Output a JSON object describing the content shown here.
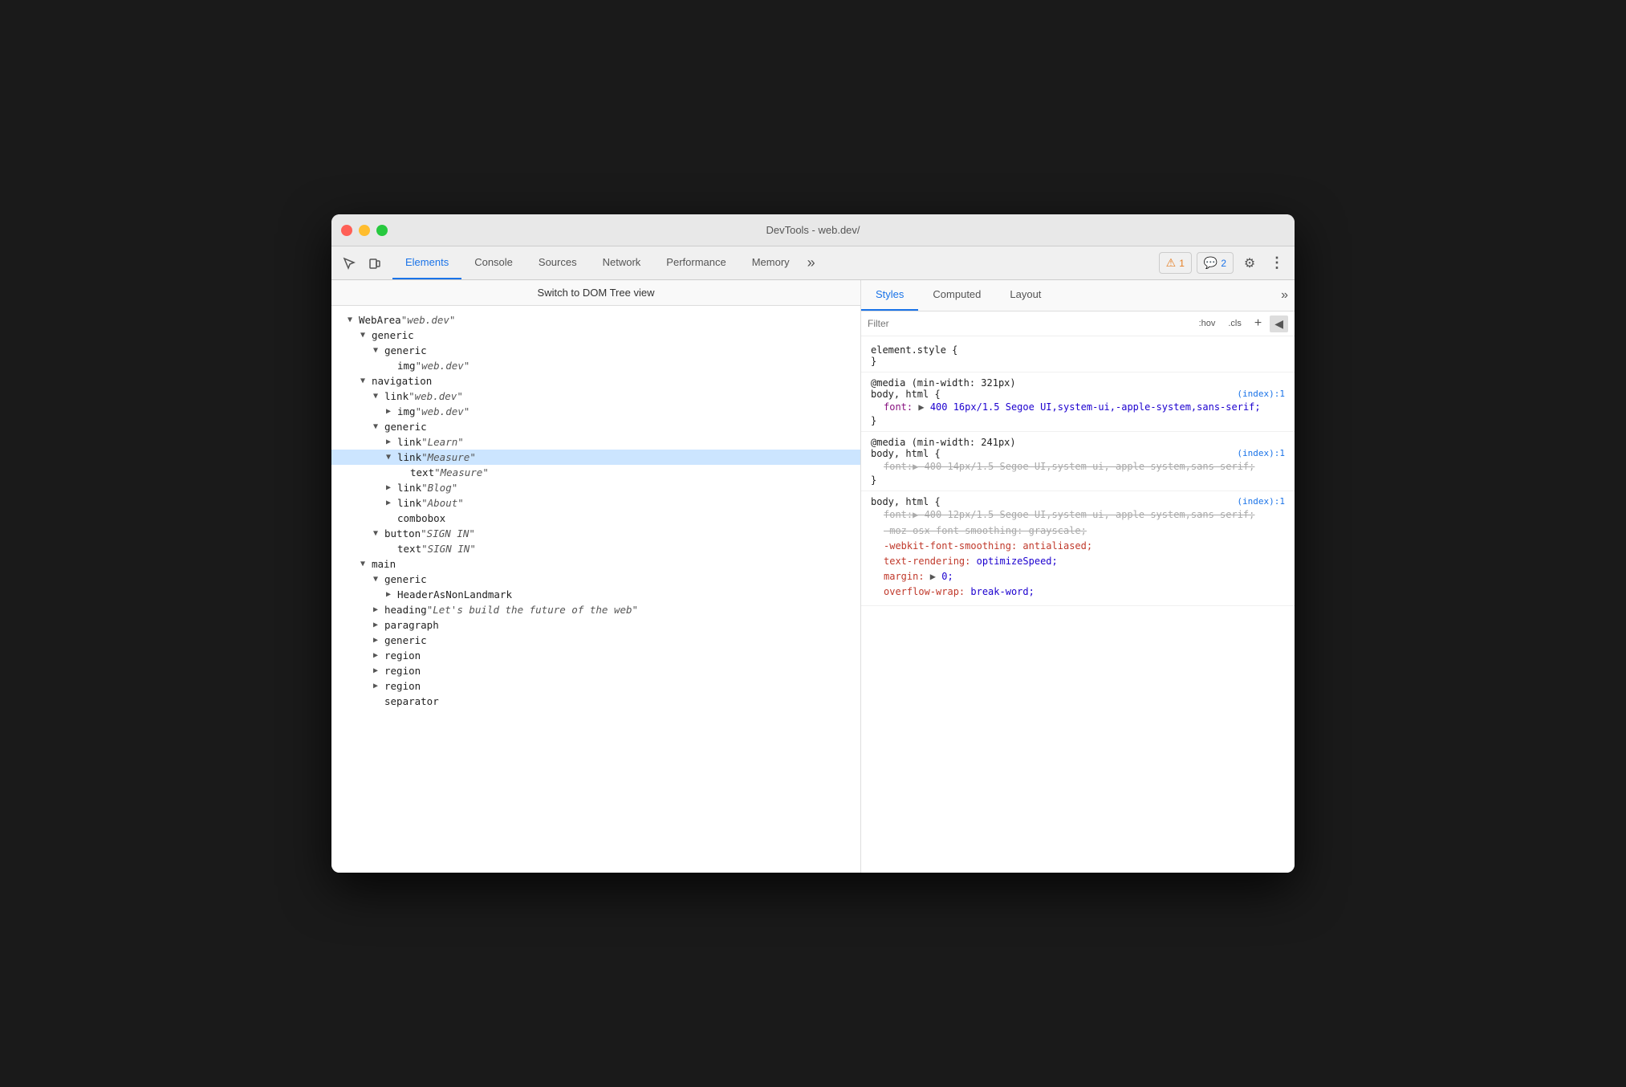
{
  "window": {
    "title": "DevTools - web.dev/"
  },
  "toolbar": {
    "tabs": [
      {
        "label": "Elements",
        "active": true
      },
      {
        "label": "Console",
        "active": false
      },
      {
        "label": "Sources",
        "active": false
      },
      {
        "label": "Network",
        "active": false
      },
      {
        "label": "Performance",
        "active": false
      },
      {
        "label": "Memory",
        "active": false
      }
    ],
    "more_label": "»",
    "warn_count": "1",
    "info_count": "2"
  },
  "dom_panel": {
    "switch_view": "Switch to DOM Tree view",
    "nodes": [
      {
        "indent": 0,
        "arrow": "▼",
        "role": "WebArea",
        "name": "\"web.dev\""
      },
      {
        "indent": 1,
        "arrow": "▼",
        "role": "generic",
        "name": ""
      },
      {
        "indent": 2,
        "arrow": "▼",
        "role": "generic",
        "name": ""
      },
      {
        "indent": 3,
        "arrow": "",
        "role": "img",
        "name": "\"web.dev\""
      },
      {
        "indent": 1,
        "arrow": "▼",
        "role": "navigation",
        "name": ""
      },
      {
        "indent": 2,
        "arrow": "▼",
        "role": "link",
        "name": "\"web.dev\""
      },
      {
        "indent": 3,
        "arrow": "▶",
        "role": "img",
        "name": "\"web.dev\""
      },
      {
        "indent": 2,
        "arrow": "▼",
        "role": "generic",
        "name": ""
      },
      {
        "indent": 3,
        "arrow": "▶",
        "role": "link",
        "name": "\"Learn\""
      },
      {
        "indent": 3,
        "arrow": "▼",
        "role": "link",
        "name": "\"Measure\"",
        "selected": true
      },
      {
        "indent": 4,
        "arrow": "",
        "role": "text",
        "name": "\"Measure\""
      },
      {
        "indent": 3,
        "arrow": "▶",
        "role": "link",
        "name": "\"Blog\""
      },
      {
        "indent": 3,
        "arrow": "▶",
        "role": "link",
        "name": "\"About\""
      },
      {
        "indent": 3,
        "arrow": "",
        "role": "combobox",
        "name": ""
      },
      {
        "indent": 2,
        "arrow": "▼",
        "role": "button",
        "name": "\"SIGN IN\""
      },
      {
        "indent": 3,
        "arrow": "",
        "role": "text",
        "name": "\"SIGN IN\""
      },
      {
        "indent": 1,
        "arrow": "▼",
        "role": "main",
        "name": ""
      },
      {
        "indent": 2,
        "arrow": "▼",
        "role": "generic",
        "name": ""
      },
      {
        "indent": 3,
        "arrow": "▶",
        "role": "HeaderAsNonLandmark",
        "name": ""
      },
      {
        "indent": 2,
        "arrow": "▶",
        "role": "heading",
        "name": "\"Let's build the future of the web\""
      },
      {
        "indent": 2,
        "arrow": "▶",
        "role": "paragraph",
        "name": ""
      },
      {
        "indent": 2,
        "arrow": "▶",
        "role": "generic",
        "name": ""
      },
      {
        "indent": 2,
        "arrow": "▶",
        "role": "region",
        "name": ""
      },
      {
        "indent": 2,
        "arrow": "▶",
        "role": "region",
        "name": ""
      },
      {
        "indent": 2,
        "arrow": "▶",
        "role": "region",
        "name": ""
      },
      {
        "indent": 2,
        "arrow": "",
        "role": "separator",
        "name": ""
      }
    ]
  },
  "styles_panel": {
    "tabs": [
      "Styles",
      "Computed",
      "Layout"
    ],
    "active_tab": "Styles",
    "filter_placeholder": "Filter",
    "filter_hov": ":hov",
    "filter_cls": ".cls",
    "rules": [
      {
        "selector": "element.style {",
        "close": "}",
        "source": "",
        "props": []
      },
      {
        "selector": "@media (min-width: 321px)",
        "sub_selector": "body, html {",
        "close": "}",
        "source": "(index):1",
        "props": [
          {
            "name": "font:",
            "arrow": "▶",
            "val": " 400 16px/1.5 Segoe UI,system-ui,-apple-system,sans-serif;",
            "striked": false,
            "red": false
          }
        ]
      },
      {
        "selector": "@media (min-width: 241px)",
        "sub_selector": "body, html {",
        "close": "}",
        "source": "(index):1",
        "props": [
          {
            "name": "font:",
            "arrow": "▶",
            "val": " 400 14px/1.5 Segoe UI,system-ui,-apple-system,sans-serif;",
            "striked": true,
            "red": false
          }
        ]
      },
      {
        "selector": "body, html {",
        "close": "}",
        "source": "(index):1",
        "props": [
          {
            "name": "font:",
            "arrow": "▶",
            "val": " 400 12px/1.5 Segoe UI,system-ui,-apple-system,sans-serif;",
            "striked": true,
            "red": false
          },
          {
            "name": "-moz-osx-font-smoothing:",
            "val": " grayscale;",
            "striked": true,
            "red": false
          },
          {
            "name": "-webkit-font-smoothing:",
            "val": " antialiased;",
            "striked": false,
            "red": true
          },
          {
            "name": "text-rendering:",
            "val": " optimizeSpeed;",
            "striked": false,
            "red": true
          },
          {
            "name": "margin:",
            "arrow": "▶",
            "val": " 0;",
            "striked": false,
            "red": true
          },
          {
            "name": "overflow-wrap:",
            "val": " break-word;",
            "striked": false,
            "red": true
          }
        ]
      }
    ]
  }
}
